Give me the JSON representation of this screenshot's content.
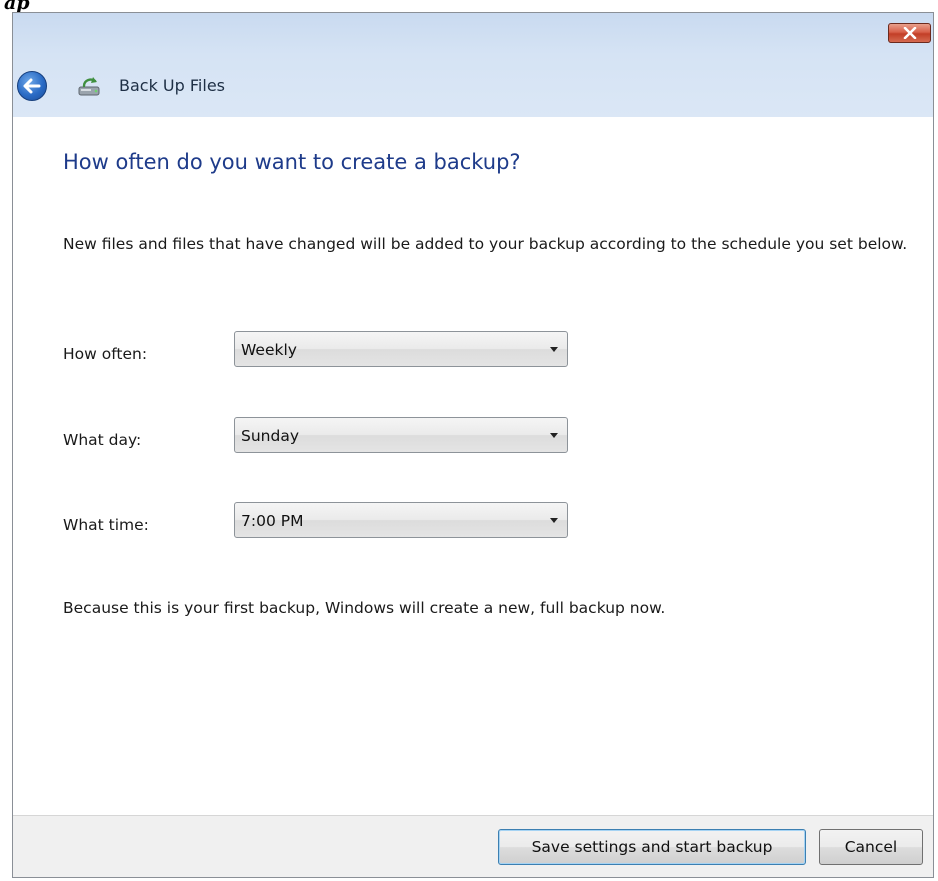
{
  "window": {
    "title": "Back Up Files"
  },
  "page": {
    "heading": "How often do you want to create a backup?",
    "description": "New files and files that have changed will be added to your backup according to the schedule you set below.",
    "note": "Because this is your first backup, Windows will create a new, full backup now."
  },
  "schedule": {
    "how_often_label": "How often:",
    "how_often_value": "Weekly",
    "what_day_label": "What day:",
    "what_day_value": "Sunday",
    "what_time_label": "What time:",
    "what_time_value": "7:00 PM"
  },
  "buttons": {
    "save_start": "Save settings and start backup",
    "cancel": "Cancel"
  },
  "icons": {
    "close": "close-icon",
    "back": "back-arrow-icon",
    "app": "backup-app-icon",
    "dropdown": "chevron-down-icon"
  },
  "colors": {
    "heading": "#1e3b8a",
    "frame": "#d5e3f4",
    "close_button": "#c8452e",
    "footer": "#f0f0f0"
  }
}
